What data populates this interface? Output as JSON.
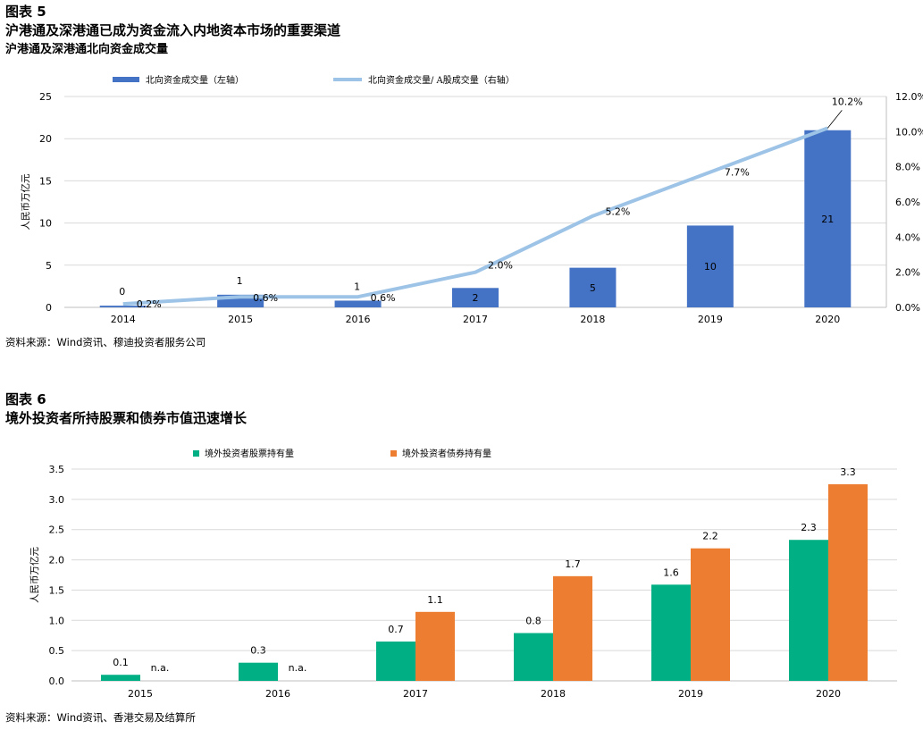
{
  "fig5": {
    "label": "图表 5",
    "title": "沪港通及深港通已成为资金流入内地资本市场的重要渠道",
    "subtitle": "沪港通及深港通北向资金成交量",
    "source": "资料来源：Wind资讯、穆迪投资者服务公司"
  },
  "fig6": {
    "label": "图表 6",
    "title": "境外投资者所持股票和债券市值迅速增长",
    "source": "资料来源：Wind资讯、香港交易及结算所"
  },
  "chart_data": [
    {
      "type": "bar",
      "combo": "bar+line",
      "categories": [
        "2014",
        "2015",
        "2016",
        "2017",
        "2018",
        "2019",
        "2020"
      ],
      "series": [
        {
          "name": "北向资金成交量（左轴）",
          "type": "bar",
          "axis": "left",
          "values": [
            0.2,
            1.5,
            0.8,
            2.3,
            4.7,
            9.7,
            21.0
          ],
          "labels": [
            "0",
            "1",
            "1",
            "2",
            "5",
            "10",
            "21"
          ]
        },
        {
          "name": "北向资金成交量/ A股成交量（右轴）",
          "type": "line",
          "axis": "right",
          "values": [
            0.2,
            0.6,
            0.6,
            2.0,
            5.2,
            7.7,
            10.2
          ],
          "labels": [
            "0.2%",
            "0.6%",
            "0.6%",
            "2.0%",
            "5.2%",
            "7.7%",
            "10.2%"
          ]
        }
      ],
      "ylabel": "人民币万亿元",
      "ylim": [
        0,
        25
      ],
      "yticks": [
        "0",
        "5",
        "10",
        "15",
        "20",
        "25"
      ],
      "y2lim": [
        0,
        12
      ],
      "y2ticks": [
        "0.0%",
        "2.0%",
        "4.0%",
        "6.0%",
        "8.0%",
        "10.0%",
        "12.0%"
      ],
      "grid": true,
      "legend": "top",
      "colors": {
        "bar": "#4472c4",
        "line": "#9dc3e6"
      }
    },
    {
      "type": "bar",
      "categories": [
        "2015",
        "2016",
        "2017",
        "2018",
        "2019",
        "2020"
      ],
      "series": [
        {
          "name": "境外投资者股票持有量",
          "values": [
            0.1,
            0.3,
            0.65,
            0.79,
            1.59,
            2.33
          ],
          "labels": [
            "0.1",
            "0.3",
            "0.7",
            "0.8",
            "1.6",
            "2.3"
          ]
        },
        {
          "name": "境外投资者债券持有量",
          "values": [
            null,
            null,
            1.14,
            1.73,
            2.19,
            3.25
          ],
          "labels": [
            "n.a.",
            "n.a.",
            "1.1",
            "1.7",
            "2.2",
            "3.3"
          ]
        }
      ],
      "ylabel": "人民币万亿元",
      "ylim": [
        0,
        3.5
      ],
      "yticks": [
        "0.0",
        "0.5",
        "1.0",
        "1.5",
        "2.0",
        "2.5",
        "3.0",
        "3.5"
      ],
      "grid": true,
      "legend": "top",
      "colors": {
        "stock": "#00b084",
        "bond": "#ed7d31"
      }
    }
  ]
}
